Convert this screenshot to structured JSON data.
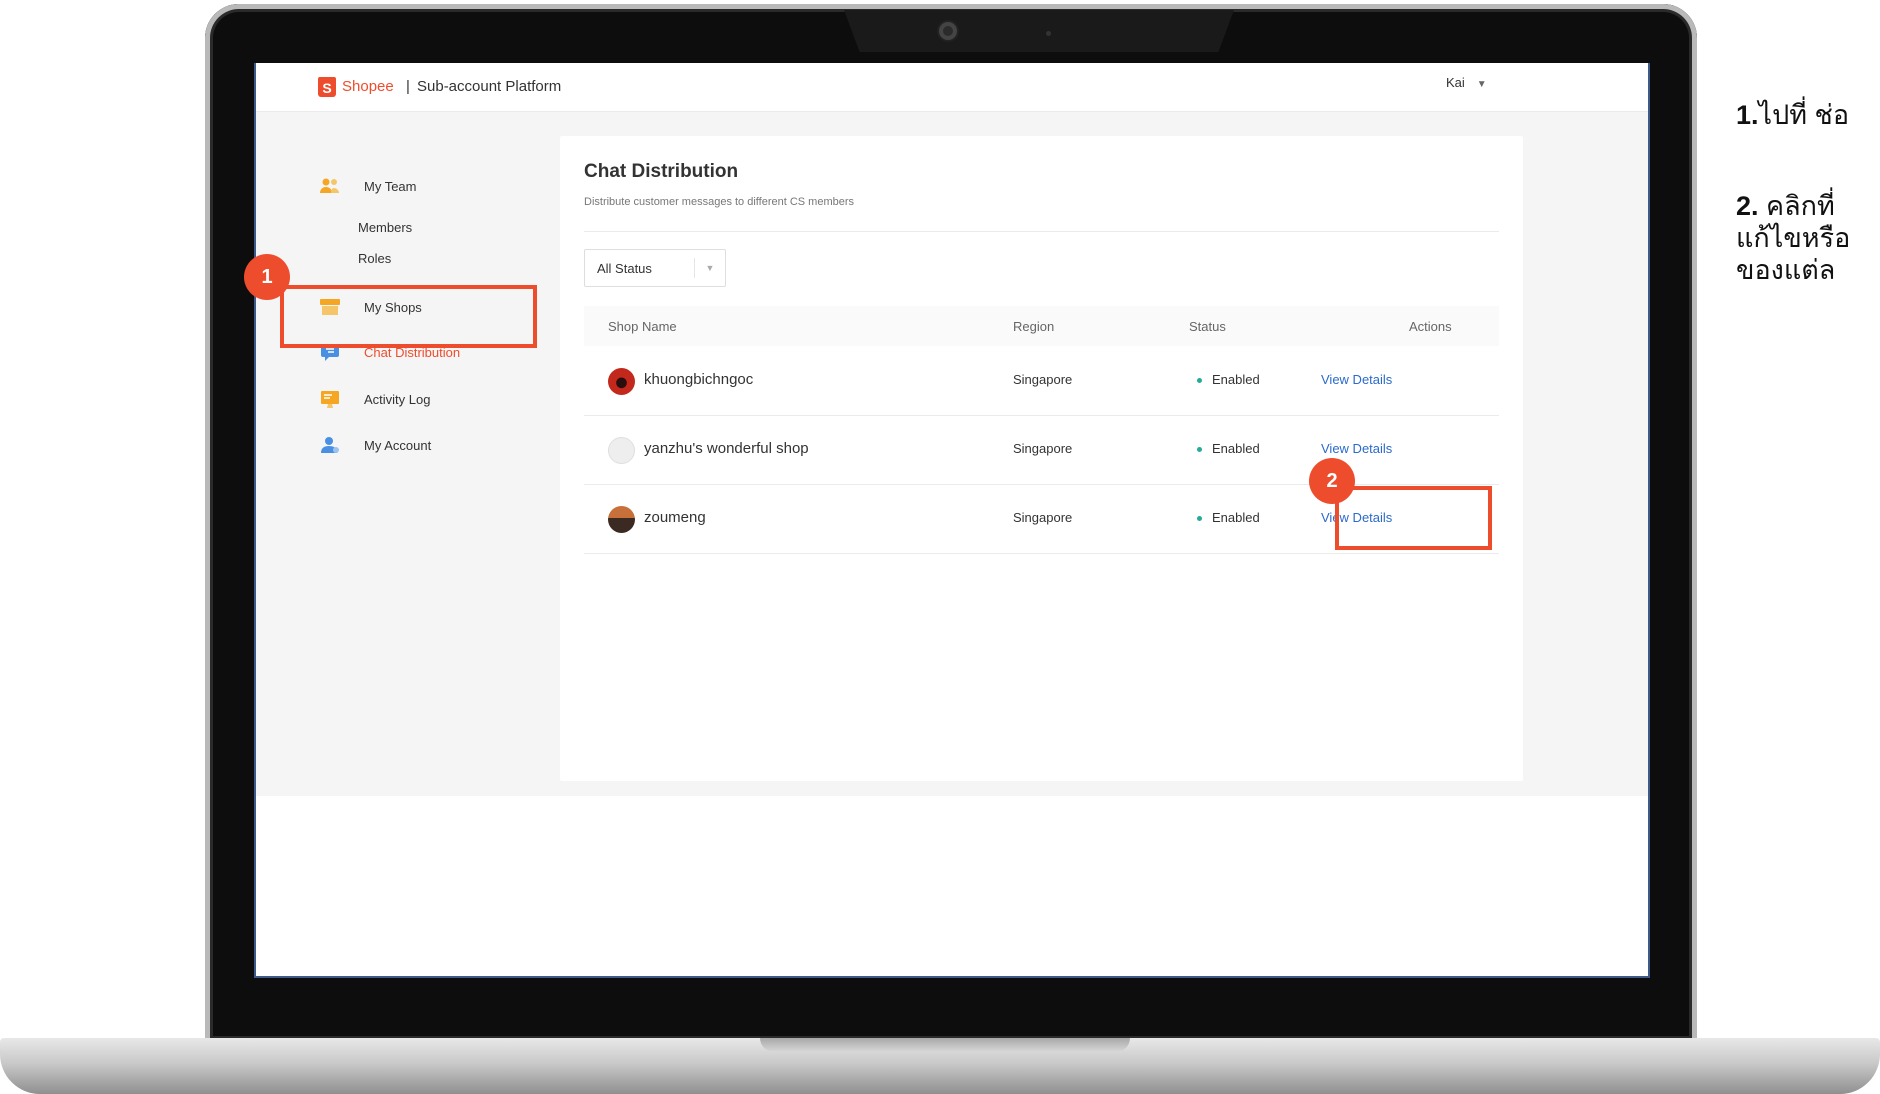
{
  "app": {
    "brand": "Shopee",
    "separator": "|",
    "platform": "Sub-account Platform",
    "user": "Kai"
  },
  "sidebar": {
    "items": [
      {
        "label": "My Team",
        "icon": "team-icon",
        "color": "#f5a623"
      },
      {
        "label": "Members"
      },
      {
        "label": "Roles"
      },
      {
        "label": "My Shops",
        "icon": "shop-icon",
        "color": "#f5a623"
      },
      {
        "label": "Chat Distribution",
        "icon": "chat-icon",
        "color": "#4a90e2",
        "active": true
      },
      {
        "label": "Activity Log",
        "icon": "activity-log-icon",
        "color": "#f5a623"
      },
      {
        "label": "My Account",
        "icon": "account-icon",
        "color": "#4a90e2"
      }
    ]
  },
  "main": {
    "title": "Chat Distribution",
    "subtitle": "Distribute customer messages to different CS members",
    "filter": {
      "selected": "All Status"
    },
    "table": {
      "headers": [
        "Shop Name",
        "Region",
        "Status",
        "Actions"
      ],
      "rows": [
        {
          "shop": "khuongbichngoc",
          "region": "Singapore",
          "status": "Enabled",
          "action": "View Details"
        },
        {
          "shop": "yanzhu's wonderful shop",
          "region": "Singapore",
          "status": "Enabled",
          "action": "View Details"
        },
        {
          "shop": "zoumeng",
          "region": "Singapore",
          "status": "Enabled",
          "action": "View Details"
        }
      ]
    }
  },
  "annotations": {
    "step1_badge": "1",
    "step2_badge": "2",
    "accent": "#ee4d2d"
  },
  "instructions": {
    "step1_num": "1.",
    "step1_text": "ไปที่ ช่อ",
    "step2_num": "2.",
    "step2_text": " คลิกที่",
    "step2_line2": "แก้ไขหรือ",
    "step2_line3": "ของแต่ล"
  }
}
